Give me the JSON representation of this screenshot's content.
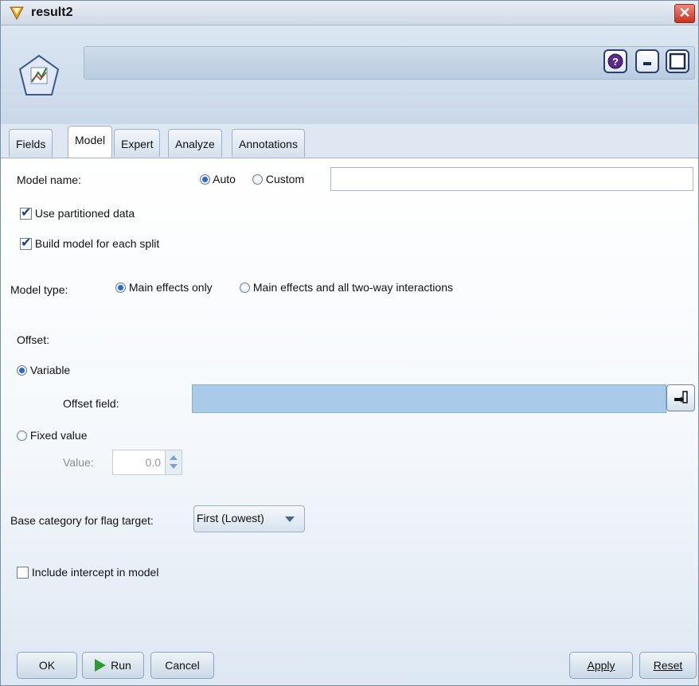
{
  "window": {
    "title": "result2",
    "close_glyph": "✕"
  },
  "header": {
    "help_glyph": "?",
    "icons": [
      "node-icon",
      "help-icon",
      "minimize-icon",
      "maximize-icon"
    ]
  },
  "tabs": [
    {
      "label": "Fields"
    },
    {
      "label": "Model",
      "active": true
    },
    {
      "label": "Expert"
    },
    {
      "label": "Analyze"
    },
    {
      "label": "Annotations"
    }
  ],
  "model": {
    "model_name_label": "Model name:",
    "auto_label": "Auto",
    "custom_label": "Custom",
    "auto_selected": true,
    "model_name_value": "",
    "use_partitioned_label": "Use partitioned data",
    "use_partitioned_checked": true,
    "build_split_label": "Build model for each split",
    "build_split_checked": true,
    "model_type_label": "Model type:",
    "main_effects_label": "Main effects only",
    "two_way_label": "Main effects and all two-way interactions",
    "main_effects_selected": true,
    "offset_label": "Offset:",
    "variable_label": "Variable",
    "variable_selected": true,
    "offset_field_label": "Offset field:",
    "offset_field_value": "",
    "fixed_value_label": "Fixed value",
    "value_label": "Value:",
    "value": "0.0",
    "base_category_label": "Base category for flag target:",
    "base_category_value": "First (Lowest)",
    "include_intercept_label": "Include intercept in model",
    "include_intercept_checked": false
  },
  "buttons": {
    "ok": "OK",
    "run": "Run",
    "cancel": "Cancel",
    "apply": "Apply",
    "reset": "Reset"
  },
  "colors": {
    "accent": "#2e6ac4",
    "field_fill": "#a9cbe9",
    "close": "#c8321e"
  }
}
